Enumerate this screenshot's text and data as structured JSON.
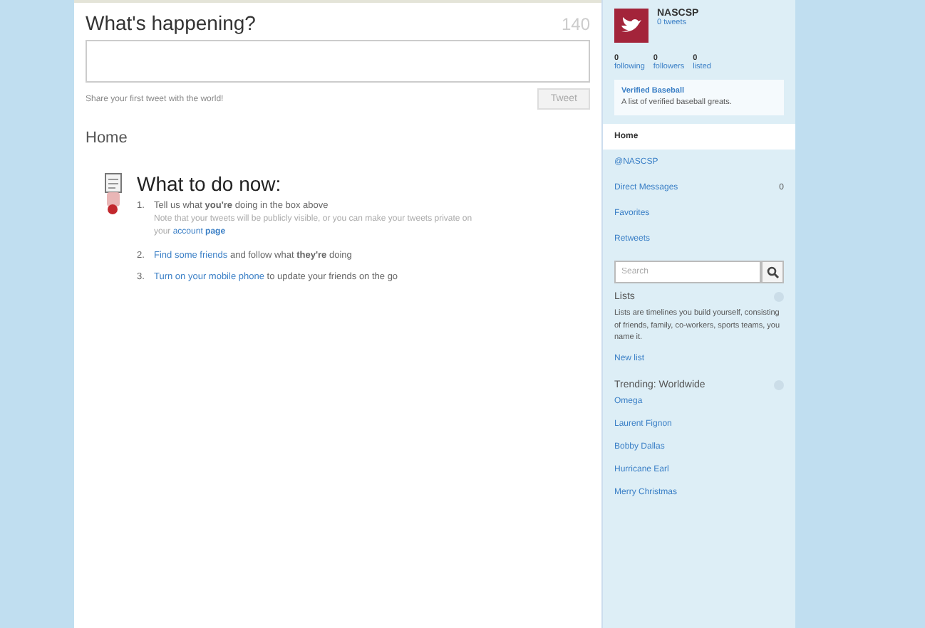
{
  "composer": {
    "title": "What's happening?",
    "counter": "140",
    "hint": "Share your first tweet with the world!",
    "button": "Tweet"
  },
  "home_title": "Home",
  "todo": {
    "title": "What to do now:",
    "steps": [
      {
        "number": "1.",
        "parts": [
          {
            "text": "Tell us what **you're** doing in the box above",
            "link": false
          }
        ],
        "note": [
          {
            "text": "Note that your tweets will be publicly visible, or you can make your tweets private on your ",
            "link": false
          },
          {
            "text": "account **page**",
            "link": true
          }
        ]
      },
      {
        "number": "2.",
        "parts": [
          {
            "text": "Find some friends",
            "link": true
          },
          {
            "text": " and follow what **they're** doing",
            "link": false
          }
        ]
      },
      {
        "number": "3.",
        "parts": [
          {
            "text": "Turn on your mobile phone",
            "link": true
          },
          {
            "text": " to update your friends on the go",
            "link": false
          }
        ]
      }
    ]
  },
  "profile": {
    "name": "NASCSP",
    "tweets": "0 tweets",
    "stats": [
      {
        "count": "0",
        "label": "following"
      },
      {
        "count": "0",
        "label": "followers"
      },
      {
        "count": "0",
        "label": "listed"
      }
    ]
  },
  "promo": {
    "title": "Verified Baseball",
    "text": "A list of verified baseball greats."
  },
  "nav": [
    {
      "label": "Home",
      "selected": true
    },
    {
      "label": "@NASCSP",
      "selected": false
    },
    {
      "label": "Direct Messages",
      "count": "0",
      "selected": false
    },
    {
      "label": "Favorites",
      "selected": false
    },
    {
      "label": "Retweets",
      "selected": false
    }
  ],
  "search": {
    "placeholder": "Search"
  },
  "lists": {
    "title": "Lists",
    "text": "Lists are timelines you build yourself, consisting of friends, family, co-workers, sports teams, you name it.",
    "link": "New list"
  },
  "trending": {
    "title": "Trending: Worldwide",
    "items": [
      "Omega",
      "Laurent Fignon",
      "Bobby Dallas",
      "Hurricane Earl",
      "Merry Christmas"
    ]
  }
}
